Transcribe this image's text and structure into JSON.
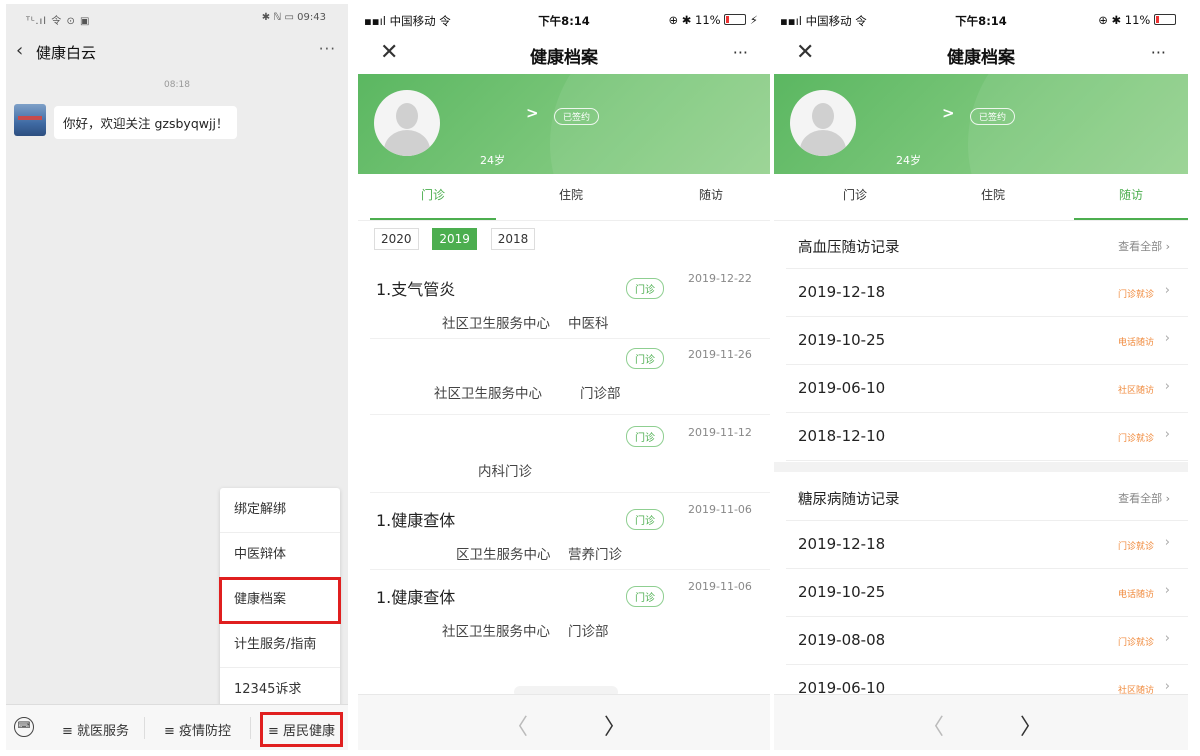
{
  "chat": {
    "status_left": "ᵀᴸ.ıl 令 ⊙ ▣",
    "status_right": "✱ ℕ ▭ 09:43",
    "title": "健康白云",
    "more": "···",
    "time": "08:18",
    "message": "你好，欢迎关注 gzsbyqwjj！",
    "menu_items": [
      "绑定解绑",
      "中医辩体",
      "健康档案",
      "计生服务/指南",
      "12345诉求"
    ],
    "bottom_tabs": [
      "≡ 就医服务",
      "≡ 疫情防控",
      "≡ 居民健康"
    ]
  },
  "phone_status": {
    "carrier": "中国移动",
    "time": "下午8:14",
    "battery": "11%"
  },
  "record": {
    "title": "健康档案",
    "close": "✕",
    "more": "···",
    "arrow": ">",
    "signed": "已签约",
    "age": "24岁",
    "tabs": [
      "门诊",
      "住院",
      "随访"
    ]
  },
  "outpatient": {
    "years": [
      "2020",
      "2019",
      "2018"
    ],
    "selected_year": "2019",
    "visits": [
      {
        "name": "1.支气管炎",
        "tag": "门诊",
        "date": "2019-12-22",
        "org": "社区卫生服务中心",
        "dept": "中医科"
      },
      {
        "name": "",
        "tag": "门诊",
        "date": "2019-11-26",
        "org": "社区卫生服务中心",
        "dept": "门诊部"
      },
      {
        "name": "",
        "tag": "门诊",
        "date": "2019-11-12",
        "org": "",
        "dept": "内科门诊"
      },
      {
        "name": "1.健康查体",
        "tag": "门诊",
        "date": "2019-11-06",
        "org": "区卫生服务中心",
        "dept": "营养门诊"
      },
      {
        "name": "1.健康查体",
        "tag": "门诊",
        "date": "2019-11-06",
        "org": "社区卫生服务中心",
        "dept": "门诊部"
      }
    ]
  },
  "followup": {
    "hypertension": {
      "title": "高血压随访记录",
      "view_all": "查看全部",
      "rows": [
        {
          "date": "2019-12-18",
          "kind": "门诊就诊"
        },
        {
          "date": "2019-10-25",
          "kind": "电话随访"
        },
        {
          "date": "2019-06-10",
          "kind": "社区随访"
        },
        {
          "date": "2018-12-10",
          "kind": "门诊就诊"
        }
      ]
    },
    "diabetes": {
      "title": "糖尿病随访记录",
      "view_all": "查看全部",
      "rows": [
        {
          "date": "2019-12-18",
          "kind": "门诊就诊"
        },
        {
          "date": "2019-10-25",
          "kind": "电话随访"
        },
        {
          "date": "2019-08-08",
          "kind": "门诊就诊"
        },
        {
          "date": "2019-06-10",
          "kind": "社区随访"
        }
      ]
    }
  },
  "pager": {
    "prev": "〈",
    "next": "〉"
  },
  "colors": {
    "accent_green": "#4cae4f",
    "highlight_red": "#e01f1f",
    "followup_orange": "#f08a3c"
  }
}
